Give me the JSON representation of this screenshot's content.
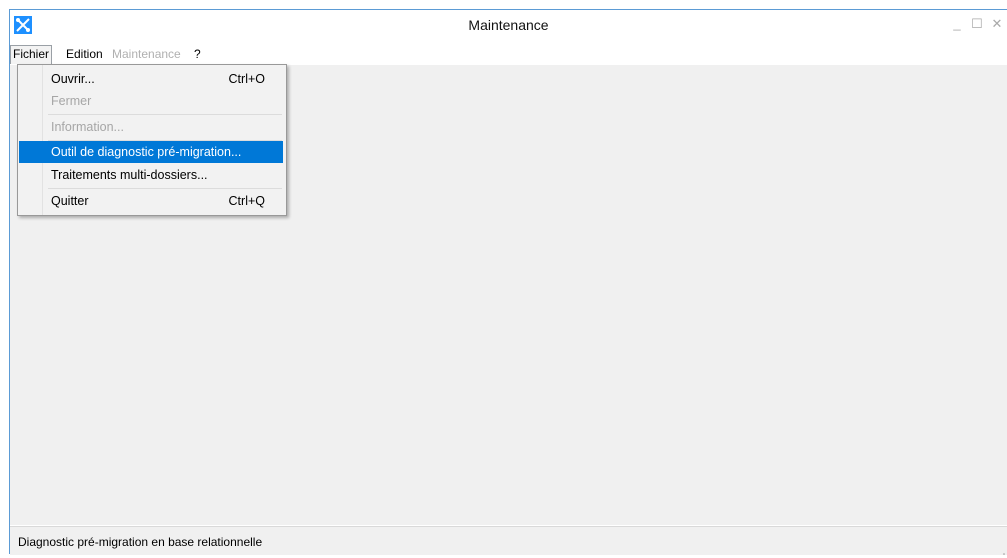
{
  "window": {
    "title": "Maintenance",
    "accent_color": "#0078d7"
  },
  "menubar": {
    "items": [
      {
        "label": "Fichier",
        "state": "open"
      },
      {
        "label": "Edition",
        "state": "enabled"
      },
      {
        "label": "Maintenance",
        "state": "disabled"
      },
      {
        "label": "?",
        "state": "enabled"
      }
    ]
  },
  "fichier_menu": {
    "items": [
      {
        "label": "Ouvrir...",
        "shortcut": "Ctrl+O",
        "enabled": true,
        "selected": false
      },
      {
        "label": "Fermer",
        "shortcut": "",
        "enabled": false,
        "selected": false
      },
      {
        "label": "Information...",
        "shortcut": "",
        "enabled": false,
        "selected": false
      },
      {
        "label": "Outil de diagnostic pré-migration...",
        "shortcut": "",
        "enabled": true,
        "selected": true
      },
      {
        "label": "Traitements multi-dossiers...",
        "shortcut": "",
        "enabled": true,
        "selected": false
      },
      {
        "label": "Quitter",
        "shortcut": "Ctrl+Q",
        "enabled": true,
        "selected": false
      }
    ]
  },
  "statusbar": {
    "text": "Diagnostic pré-migration en base relationnelle"
  },
  "icons": {
    "app": "tools-icon",
    "minimize": "minimize-icon",
    "maximize": "maximize-icon",
    "close": "close-icon",
    "grip": "resize-grip-icon"
  }
}
